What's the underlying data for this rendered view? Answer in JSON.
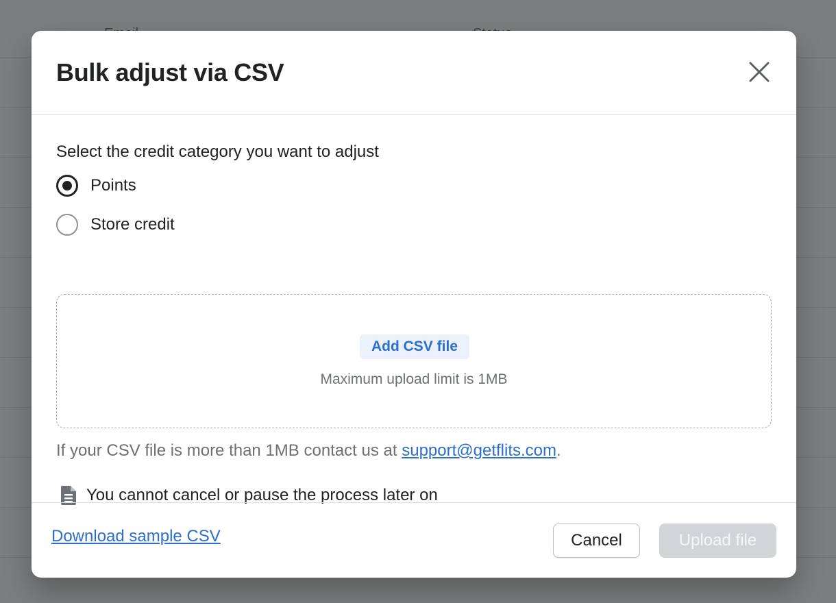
{
  "background": {
    "columns": [
      "Email",
      "Status"
    ]
  },
  "modal": {
    "title": "Bulk adjust via CSV",
    "close_icon": "close-icon",
    "category_prompt": "Select the credit category you want to adjust",
    "options": [
      {
        "label": "Points",
        "selected": true
      },
      {
        "label": "Store credit",
        "selected": false
      }
    ],
    "dropzone": {
      "button_label": "Add CSV file",
      "hint": "Maximum upload limit is 1MB"
    },
    "contact": {
      "prefix": "If your CSV file is more than 1MB contact us at ",
      "email": "support@getflits.com",
      "suffix": "."
    },
    "warning": {
      "icon": "document-icon",
      "text": "You cannot cancel or pause the process later on"
    },
    "footer": {
      "download_label": "Download sample CSV",
      "cancel_label": "Cancel",
      "upload_label": "Upload file",
      "upload_disabled": true
    }
  },
  "colors": {
    "accent": "#2c6ecb",
    "text": "#202223",
    "muted": "#6d7175",
    "disabled_button": "#d2d5d8",
    "overlay": "#7a7b7c"
  }
}
